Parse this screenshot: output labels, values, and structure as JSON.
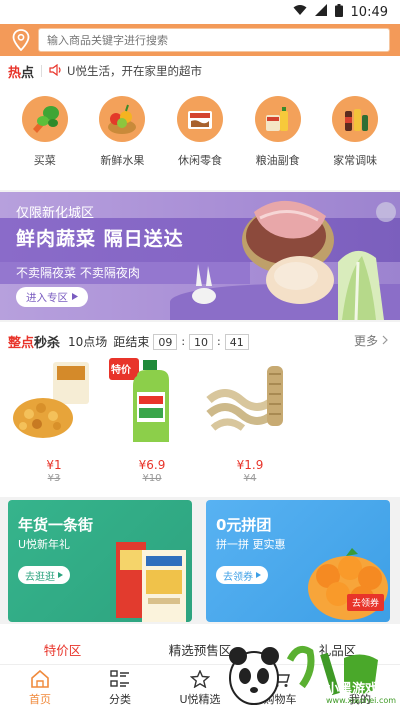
{
  "status_bar": {
    "time": "10:49"
  },
  "search": {
    "placeholder": "输入商品关键字进行搜索"
  },
  "hot": {
    "label_red": "热",
    "label_black": "点",
    "news": "U悦生活，开在家里的超市"
  },
  "categories": [
    {
      "label": "买菜",
      "icon": "vegetables-icon"
    },
    {
      "label": "新鲜水果",
      "icon": "fruit-basket-icon"
    },
    {
      "label": "休闲零食",
      "icon": "snack-icon"
    },
    {
      "label": "粮油副食",
      "icon": "grain-oil-icon"
    },
    {
      "label": "家常调味",
      "icon": "seasoning-icon"
    }
  ],
  "banner": {
    "subtitle": "仅限新化城区",
    "title": "鲜肉蔬菜  隔日送达",
    "desc": "不卖隔夜菜  不卖隔夜肉",
    "button": "进入专区"
  },
  "seckill": {
    "title_red": "整点",
    "title_black": "秒杀",
    "round": "10点场",
    "countdown_label": "距结束",
    "hours": "09",
    "minutes": "10",
    "seconds": "41",
    "more": "更多",
    "products": [
      {
        "price": "¥1",
        "orig": "¥3",
        "icon": "corn-snack-icon"
      },
      {
        "price": "¥6.9",
        "orig": "¥10",
        "icon": "detergent-bottle-icon",
        "badge": "特价"
      },
      {
        "price": "¥1.9",
        "orig": "¥4",
        "icon": "dried-noodle-icon"
      }
    ]
  },
  "promos": [
    {
      "title": "年货一条街",
      "subtitle": "U悦新年礼",
      "button": "去逛逛"
    },
    {
      "title": "0元拼团",
      "subtitle": "拼一拼  更实惠",
      "button": "去领券",
      "tag": "去领券"
    }
  ],
  "sub_tabs": [
    "特价区",
    "精选预售区",
    "礼品区"
  ],
  "tabbar": [
    {
      "label": "首页",
      "icon": "home-icon",
      "active": true
    },
    {
      "label": "分类",
      "icon": "category-list-icon"
    },
    {
      "label": "U悦精选",
      "icon": "star-icon"
    },
    {
      "label": "购物车",
      "icon": "cart-icon"
    },
    {
      "label": "我的",
      "icon": "user-icon"
    }
  ],
  "watermark": {
    "text": "小黑游戏",
    "url": "www.xiaohei.com"
  },
  "colors": {
    "accent": "#f39a59",
    "red": "#e8342a",
    "banner": "#a98fd6",
    "green": "#2da37f",
    "blue": "#3d9fe6"
  }
}
